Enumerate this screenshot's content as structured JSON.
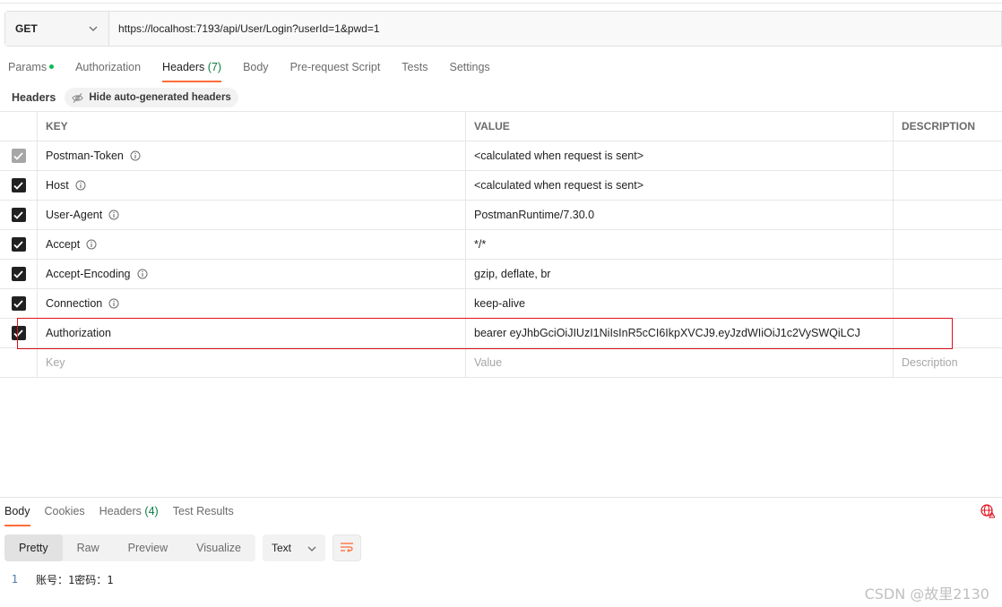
{
  "request": {
    "method": "GET",
    "url": "https://localhost:7193/api/User/Login?userId=1&pwd=1"
  },
  "request_tabs": [
    {
      "label": "Params",
      "count": ""
    },
    {
      "label": "Authorization",
      "count": ""
    },
    {
      "label": "Headers",
      "count": "(7)"
    },
    {
      "label": "Body",
      "count": ""
    },
    {
      "label": "Pre-request Script",
      "count": ""
    },
    {
      "label": "Tests",
      "count": ""
    },
    {
      "label": "Settings",
      "count": ""
    }
  ],
  "headers_panel": {
    "label": "Headers",
    "hide_button": "Hide auto-generated headers"
  },
  "table": {
    "columns": {
      "key": "KEY",
      "value": "VALUE",
      "description": "DESCRIPTION"
    },
    "rows": [
      {
        "key": "Postman-Token",
        "value": "<calculated when request is sent>"
      },
      {
        "key": "Host",
        "value": "<calculated when request is sent>"
      },
      {
        "key": "User-Agent",
        "value": "PostmanRuntime/7.30.0"
      },
      {
        "key": "Accept",
        "value": "*/*"
      },
      {
        "key": "Accept-Encoding",
        "value": "gzip, deflate, br"
      },
      {
        "key": "Connection",
        "value": "keep-alive"
      },
      {
        "key": "Authorization",
        "value": "bearer eyJhbGciOiJIUzI1NiIsInR5cCI6IkpXVCJ9.eyJzdWIiOiJ1c2VySWQiLCJ"
      }
    ],
    "placeholders": {
      "key": "Key",
      "value": "Value",
      "description": "Description"
    }
  },
  "response_tabs": [
    {
      "label": "Body",
      "count": ""
    },
    {
      "label": "Cookies",
      "count": ""
    },
    {
      "label": "Headers",
      "count": "(4)"
    },
    {
      "label": "Test Results",
      "count": ""
    }
  ],
  "response_toolbar": {
    "views": [
      "Pretty",
      "Raw",
      "Preview",
      "Visualize"
    ],
    "format": "Text"
  },
  "response_body": {
    "line_number": "1",
    "content": "账号：1密码：1"
  },
  "watermark": "CSDN @故里2130",
  "colors": {
    "accent": "#ff6c37",
    "highlight": "#e0101e",
    "count": "#0a7c42"
  }
}
